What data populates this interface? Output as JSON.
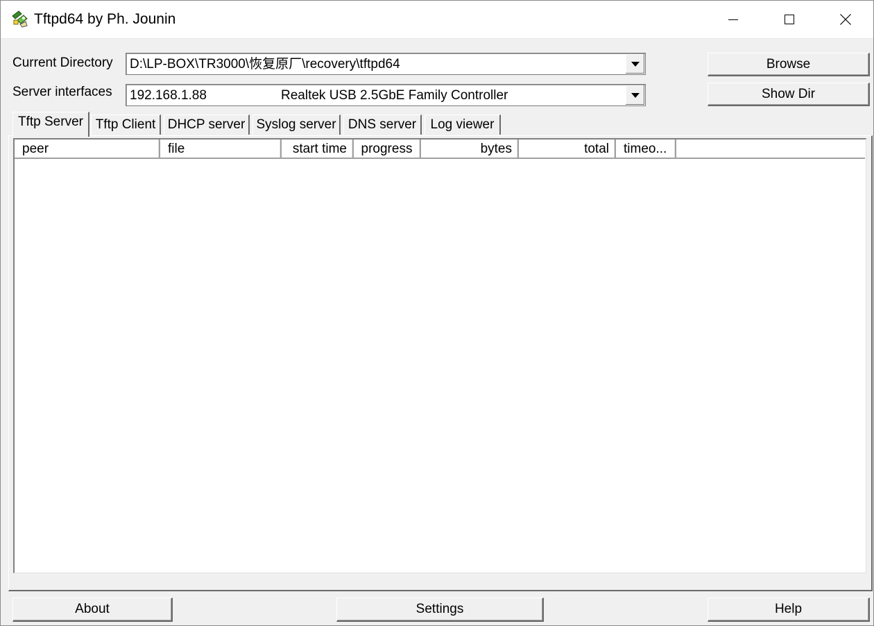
{
  "window": {
    "title": "Tftpd64 by Ph. Jounin",
    "icons": [
      "app-icon",
      "minimize-icon",
      "maximize-icon",
      "close-icon"
    ]
  },
  "form": {
    "current_directory_label": "Current Directory",
    "current_directory_value": "D:\\LP-BOX\\TR3000\\恢复原厂\\recovery\\tftpd64",
    "server_interfaces_label": "Server interfaces",
    "server_interface_ip": "192.168.1.88",
    "server_interface_name": "Realtek USB 2.5GbE Family Controller",
    "browse_label": "Browse",
    "show_dir_label": "Show Dir"
  },
  "tabs": [
    {
      "label": "Tftp Server",
      "active": true
    },
    {
      "label": "Tftp Client",
      "active": false
    },
    {
      "label": "DHCP server",
      "active": false
    },
    {
      "label": "Syslog server",
      "active": false
    },
    {
      "label": "DNS server",
      "active": false
    },
    {
      "label": "Log viewer",
      "active": false
    }
  ],
  "table": {
    "columns": [
      "peer",
      "file",
      "start time",
      "progress",
      "bytes",
      "total",
      "timeo..."
    ],
    "rows": []
  },
  "footer": {
    "about_label": "About",
    "settings_label": "Settings",
    "help_label": "Help"
  }
}
